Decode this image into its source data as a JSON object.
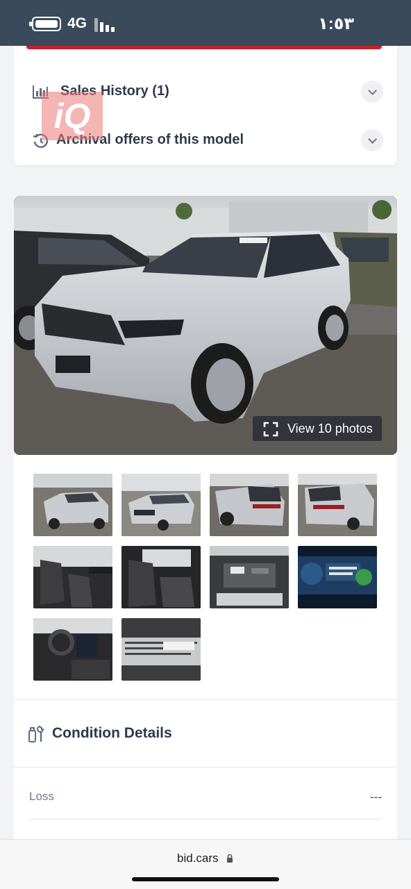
{
  "status_bar": {
    "network": "4G",
    "time": "١:٥٣"
  },
  "accordion": {
    "sales_history": "Sales History (1)",
    "archival_offers": "Archival offers of this model"
  },
  "watermark": {
    "text": "iQ"
  },
  "gallery": {
    "view_photos_label": "View 10 photos",
    "thumbnails": [
      "exterior-front-left",
      "exterior-front",
      "exterior-rear-right",
      "exterior-rear",
      "interior-front-seats",
      "interior-rear-seats",
      "engine-bay",
      "instrument-cluster",
      "dashboard",
      "vin-label"
    ]
  },
  "condition": {
    "title": "Condition Details",
    "rows": [
      {
        "label": "Loss",
        "value": "---"
      }
    ]
  },
  "browser": {
    "url": "bid.cars"
  },
  "colors": {
    "status_bar_bg": "#3a4a5a",
    "accent_red": "#c4222b",
    "card_bg": "#ffffff",
    "page_bg": "#f2f3f5"
  }
}
